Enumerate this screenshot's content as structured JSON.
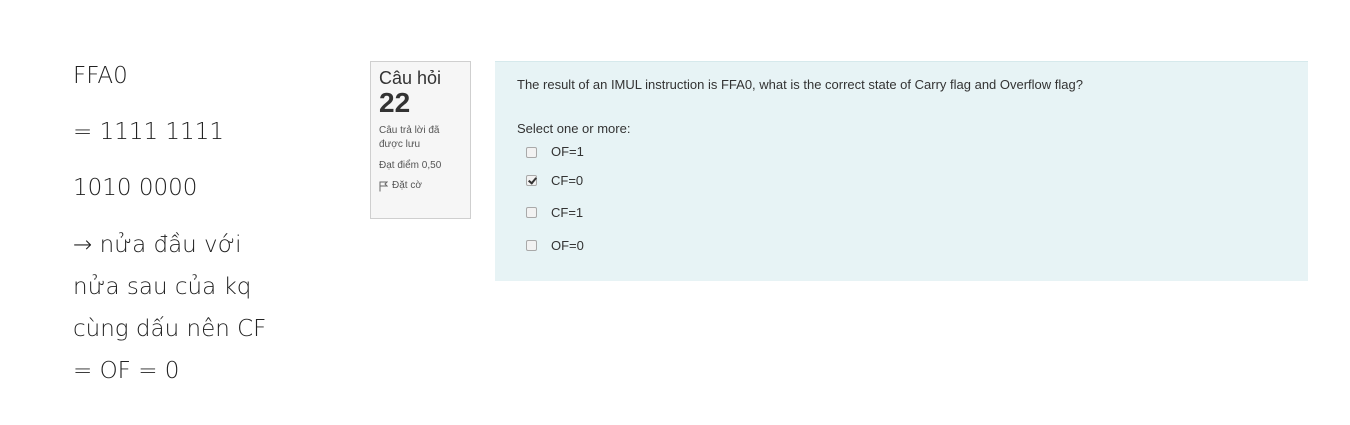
{
  "notes": {
    "lines": [
      "FFA0",
      "= 1111 1111",
      "1010 0000",
      "→ nửa đầu với",
      "nửa sau của kq",
      "cùng dấu nên CF",
      "= OF = 0"
    ]
  },
  "question_info": {
    "label": "Câu hỏi",
    "number": "22",
    "state": "Câu trả lời đã được lưu",
    "grade": "Đạt điểm 0,50",
    "flag_label": "Đặt cờ",
    "flag_icon": "flag-icon"
  },
  "question": {
    "text": "The result of an IMUL instruction is FFA0, what is the correct state of Carry flag and Overflow flag?",
    "prompt": "Select one or more:",
    "answers": [
      {
        "label": "OF=1",
        "checked": false
      },
      {
        "label": "CF=0",
        "checked": true
      },
      {
        "label": "CF=1",
        "checked": false
      },
      {
        "label": "OF=0",
        "checked": false
      }
    ]
  },
  "colors": {
    "content_background": "#e7f3f5",
    "info_background": "#f6f6f6",
    "text": "#333333"
  }
}
